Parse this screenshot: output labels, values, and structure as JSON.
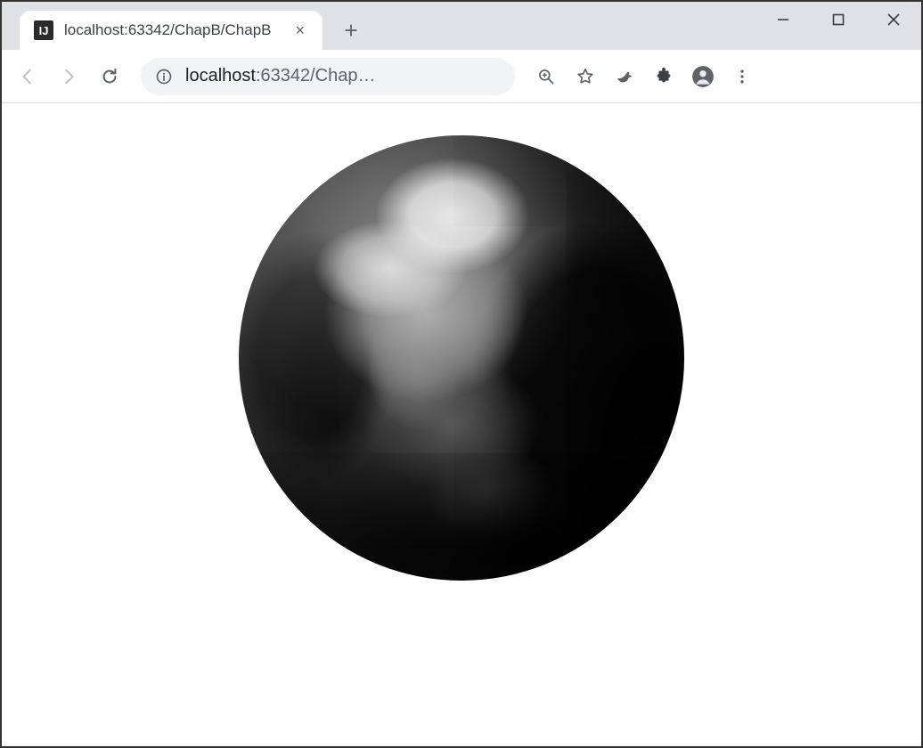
{
  "window": {
    "minimize_tip": "Minimize",
    "maximize_tip": "Maximize",
    "close_tip": "Close"
  },
  "tab": {
    "favicon_label": "IJ",
    "title": "localhost:63342/ChapB/ChapB",
    "close_tip": "×"
  },
  "toolbar": {
    "back_tip": "Back",
    "forward_tip": "Forward",
    "reload_tip": "Reload",
    "site_info_tip": "View site information",
    "zoom_tip": "Zoom",
    "bookmark_tip": "Bookmark this tab",
    "bird_ext_tip": "Extension",
    "extensions_tip": "Extensions",
    "profile_tip": "You",
    "menu_tip": "Customize and control"
  },
  "omnibox": {
    "host": "localhost",
    "port_path": ":63342/Chap…"
  },
  "new_tab": {
    "label": "+",
    "tip": "New Tab"
  },
  "content": {
    "image_alt": "earth-globe"
  }
}
